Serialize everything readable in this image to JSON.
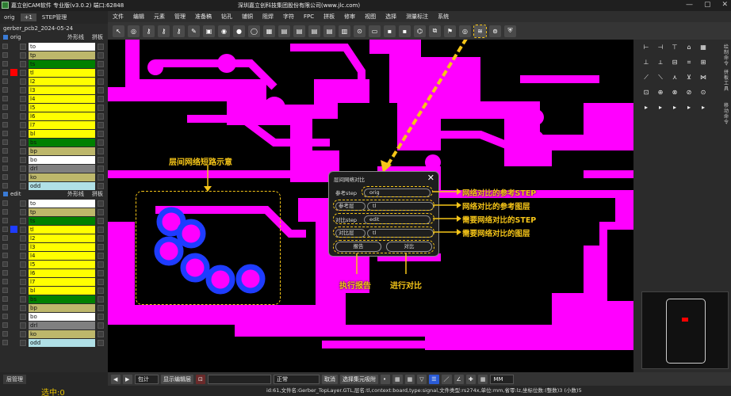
{
  "window": {
    "title": "嘉立创CAM软件 专业版(v3.0.2) 端口:62848",
    "company": "深圳嘉立创科技集团股份有限公司(www.jlc.com)",
    "buttons": [
      "—",
      "▢",
      "✕"
    ]
  },
  "menu": [
    "文件",
    "编辑",
    "元素",
    "管理",
    "准备稿",
    "钻孔",
    "铺铜",
    "阻焊",
    "字符",
    "FPC",
    "拼板",
    "修审",
    "视图",
    "选择",
    "测量标注",
    "系统"
  ],
  "left_panel": {
    "tabs": [
      "orig",
      "+1",
      "STEP管理"
    ],
    "pcb_name": "gerber_pcb2_2024-05-24",
    "steps": [
      {
        "name": "orig",
        "col_a": "外形线",
        "col_b": "拼板",
        "layers": [
          {
            "name": "to",
            "color": "#ffffff",
            "swatch": ""
          },
          {
            "name": "tp",
            "color": "#bdb76b",
            "swatch": ""
          },
          {
            "name": "ts",
            "color": "#008000",
            "swatch": ""
          },
          {
            "name": "tl",
            "color": "#ffff00",
            "swatch": "#ff0000"
          },
          {
            "name": "l2",
            "color": "#ffff00",
            "swatch": ""
          },
          {
            "name": "l3",
            "color": "#ffff00",
            "swatch": ""
          },
          {
            "name": "l4",
            "color": "#ffff00",
            "swatch": ""
          },
          {
            "name": "l5",
            "color": "#ffff00",
            "swatch": ""
          },
          {
            "name": "l6",
            "color": "#ffff00",
            "swatch": ""
          },
          {
            "name": "l7",
            "color": "#ffff00",
            "swatch": ""
          },
          {
            "name": "bl",
            "color": "#ffff00",
            "swatch": ""
          },
          {
            "name": "bs",
            "color": "#008000",
            "swatch": ""
          },
          {
            "name": "bp",
            "color": "#bdb76b",
            "swatch": ""
          },
          {
            "name": "bo",
            "color": "#ffffff",
            "swatch": ""
          },
          {
            "name": "drl",
            "color": "#808080",
            "swatch": ""
          },
          {
            "name": "ko",
            "color": "#bdb76b",
            "swatch": ""
          },
          {
            "name": "odd",
            "color": "#b0e0e6",
            "swatch": ""
          }
        ]
      },
      {
        "name": "edit",
        "col_a": "外形线",
        "col_b": "拼板",
        "layers": [
          {
            "name": "to",
            "color": "#ffffff",
            "swatch": ""
          },
          {
            "name": "tp",
            "color": "#bdb76b",
            "swatch": ""
          },
          {
            "name": "ts",
            "color": "#008000",
            "swatch": ""
          },
          {
            "name": "tl",
            "color": "#ffff00",
            "swatch": "#1e3cff"
          },
          {
            "name": "l2",
            "color": "#ffff00",
            "swatch": ""
          },
          {
            "name": "l3",
            "color": "#ffff00",
            "swatch": ""
          },
          {
            "name": "l4",
            "color": "#ffff00",
            "swatch": ""
          },
          {
            "name": "l5",
            "color": "#ffff00",
            "swatch": ""
          },
          {
            "name": "l6",
            "color": "#ffff00",
            "swatch": ""
          },
          {
            "name": "l7",
            "color": "#ffff00",
            "swatch": ""
          },
          {
            "name": "bl",
            "color": "#ffff00",
            "swatch": ""
          },
          {
            "name": "bs",
            "color": "#008000",
            "swatch": ""
          },
          {
            "name": "bp",
            "color": "#bdb76b",
            "swatch": ""
          },
          {
            "name": "bo",
            "color": "#ffffff",
            "swatch": ""
          },
          {
            "name": "drl",
            "color": "#808080",
            "swatch": ""
          },
          {
            "name": "ko",
            "color": "#bdb76b",
            "swatch": ""
          },
          {
            "name": "odd",
            "color": "#b0e0e6",
            "swatch": ""
          }
        ]
      }
    ],
    "footer_tab": "层管理",
    "selected": "选中:0"
  },
  "toolbar": {
    "icons": [
      "pointer-icon",
      "circle-icon",
      "key-icon",
      "key-icon",
      "key-icon",
      "pen-icon",
      "rect-icon",
      "pad-icon",
      "dot-icon",
      "ring-icon",
      "grid-icon",
      "table-icon",
      "table-icon",
      "table-icon",
      "table-icon",
      "layers-icon",
      "drill-icon",
      "display-icon",
      "chip-icon",
      "chip-icon",
      "net-icon",
      "copy-icon",
      "flag-icon",
      "circle-icon",
      "layer-compare-icon",
      "record-icon",
      "shield-icon"
    ]
  },
  "dialog": {
    "title": "层间网络对比",
    "ref_step_label": "参考step",
    "ref_step_value": "orig",
    "ref_layer_label": "参考层",
    "ref_layer_value": "tl",
    "cmp_step_label": "对比step",
    "cmp_step_value": "edit",
    "cmp_layer_label": "对比层",
    "cmp_layer_value": "tl",
    "report_button": "报告",
    "compare_button": "对比"
  },
  "annotations": {
    "short_demo": "层间网络短路示意",
    "ref_step": "网络对比的参考STEP",
    "ref_layer": "网络对比的参考图层",
    "cmp_step": "需要网络对比的STEP",
    "cmp_layer": "需要网络对比的图层",
    "report": "执行报告",
    "compare": "进行对比"
  },
  "bottom": {
    "zoom_mode": "包计",
    "display_mode": "显示编辑层",
    "field1": "",
    "combo": "正常",
    "checkbox1": "取消",
    "checkbox2": "选择集元吸附",
    "units": "MM"
  },
  "status": "id:61,文件名:Gerber_TopLayer.GTL,层名:tl,context:board,type:signal,文件类型:rs274x,单位:mm,省零:lz,坐标位数:(整数)3 (小数)5",
  "right_panel": {
    "vertical_labels": [
      "绘制命令",
      "拼板工具",
      "移动命令"
    ]
  },
  "colors": {
    "copper": "#ff00ff",
    "background": "#000000",
    "pad_ring": "#1e3cff",
    "accent": "#f5c518"
  }
}
